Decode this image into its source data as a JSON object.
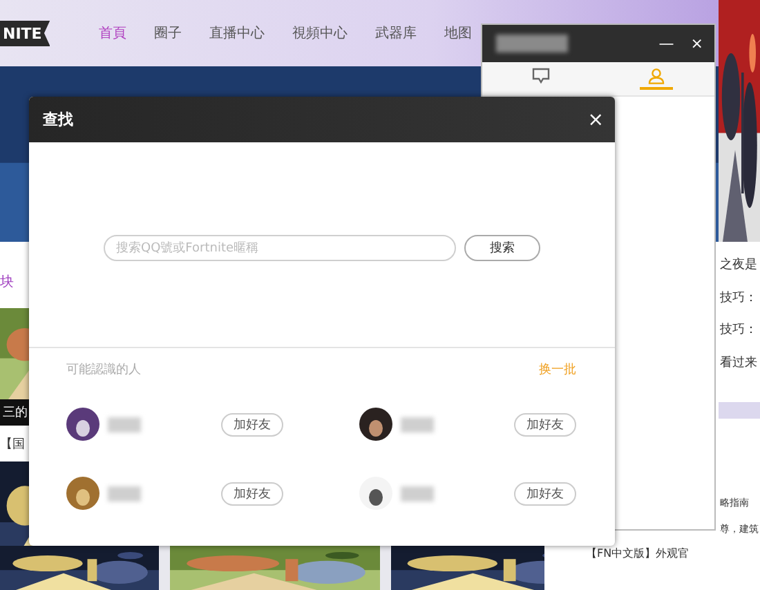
{
  "site_nav": {
    "logo": "NITE",
    "items": [
      {
        "label": "首頁",
        "selected": true
      },
      {
        "label": "圈子",
        "selected": false
      },
      {
        "label": "直播中心",
        "selected": false
      },
      {
        "label": "視頻中心",
        "selected": false
      },
      {
        "label": "武器库",
        "selected": false
      },
      {
        "label": "地图",
        "selected": false
      }
    ]
  },
  "left_column": {
    "heading": "块",
    "thumbnail_caption": "三的",
    "link": "【国"
  },
  "right_column": {
    "lines": [
      "之夜是",
      "技巧：",
      "技巧：",
      "看过来"
    ],
    "lower_lines": [
      "略指南",
      "尊，建筑"
    ],
    "footer_link": "【FN中文版】外观官"
  },
  "chat_panel": {
    "minimize": "—",
    "close": "×",
    "tabs": [
      {
        "kind": "messages",
        "selected": false
      },
      {
        "kind": "contacts",
        "selected": true
      }
    ]
  },
  "find_dialog": {
    "title": "查找",
    "close": "×",
    "search": {
      "placeholder": "搜索QQ號或Fortnite暱稱",
      "button": "搜索"
    },
    "suggestions": {
      "label": "可能認識的人",
      "refresh": "换一批",
      "people": [
        {
          "button": "加好友"
        },
        {
          "button": "加好友"
        },
        {
          "button": "加好友"
        },
        {
          "button": "加好友"
        }
      ]
    }
  }
}
